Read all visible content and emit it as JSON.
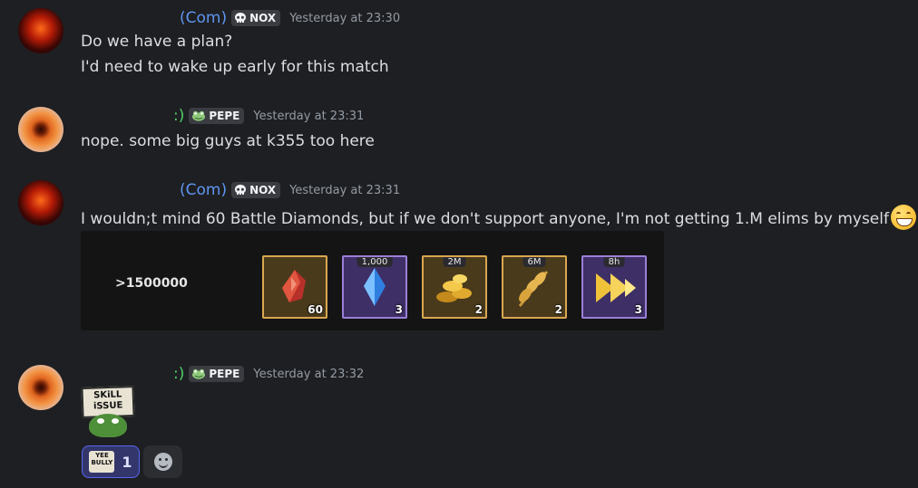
{
  "messages": [
    {
      "author": "(Com)",
      "author_color": "#5e95f0",
      "tag": "NOX",
      "tag_icon": "skull-icon",
      "timestamp": "Yesterday at 23:30",
      "lines": [
        "Do we have a plan?",
        "I'd need to wake up early for this match"
      ]
    },
    {
      "author": ":)",
      "author_color": "#4fcf6c",
      "tag": "PEPE",
      "tag_icon": "frog-icon",
      "timestamp": "Yesterday at 23:31",
      "lines": [
        "nope. some big guys at k355 too here"
      ]
    },
    {
      "author": "(Com)",
      "author_color": "#5e95f0",
      "tag": "NOX",
      "tag_icon": "skull-icon",
      "timestamp": "Yesterday at 23:31",
      "lines": [
        "I wouldn;t mind 60 Battle Diamonds, but if we don't support anyone, I'm not getting 1.M elims by myself"
      ],
      "trailing_emoji": "grinning-face-icon",
      "embed": {
        "threshold": ">1500000",
        "rewards": [
          {
            "icon": "red-gem-icon",
            "label": "",
            "count": "60",
            "frame": "gold"
          },
          {
            "icon": "blue-crystal-icon",
            "label": "1,000",
            "count": "3",
            "frame": "purple"
          },
          {
            "icon": "gold-coins-icon",
            "label": "2M",
            "count": "2",
            "frame": "gold"
          },
          {
            "icon": "wheat-icon",
            "label": "6M",
            "count": "2",
            "frame": "gold"
          },
          {
            "icon": "speedup-arrow-icon",
            "label": "8h",
            "count": "3",
            "frame": "purple"
          }
        ]
      }
    },
    {
      "author": ":)",
      "author_color": "#4fcf6c",
      "tag": "PEPE",
      "tag_icon": "frog-icon",
      "timestamp": "Yesterday at 23:32",
      "sticker": {
        "icon": "skill-issue-sticker",
        "text_line1": "SKiLL",
        "text_line2": "iSSUE"
      },
      "reactions": [
        {
          "icon": "yee-bully-sticker-icon",
          "text_line1": "YEE",
          "text_line2": "BULLY",
          "count": "1",
          "active": true
        }
      ],
      "add_reaction_icon": "add-reaction-icon"
    }
  ]
}
